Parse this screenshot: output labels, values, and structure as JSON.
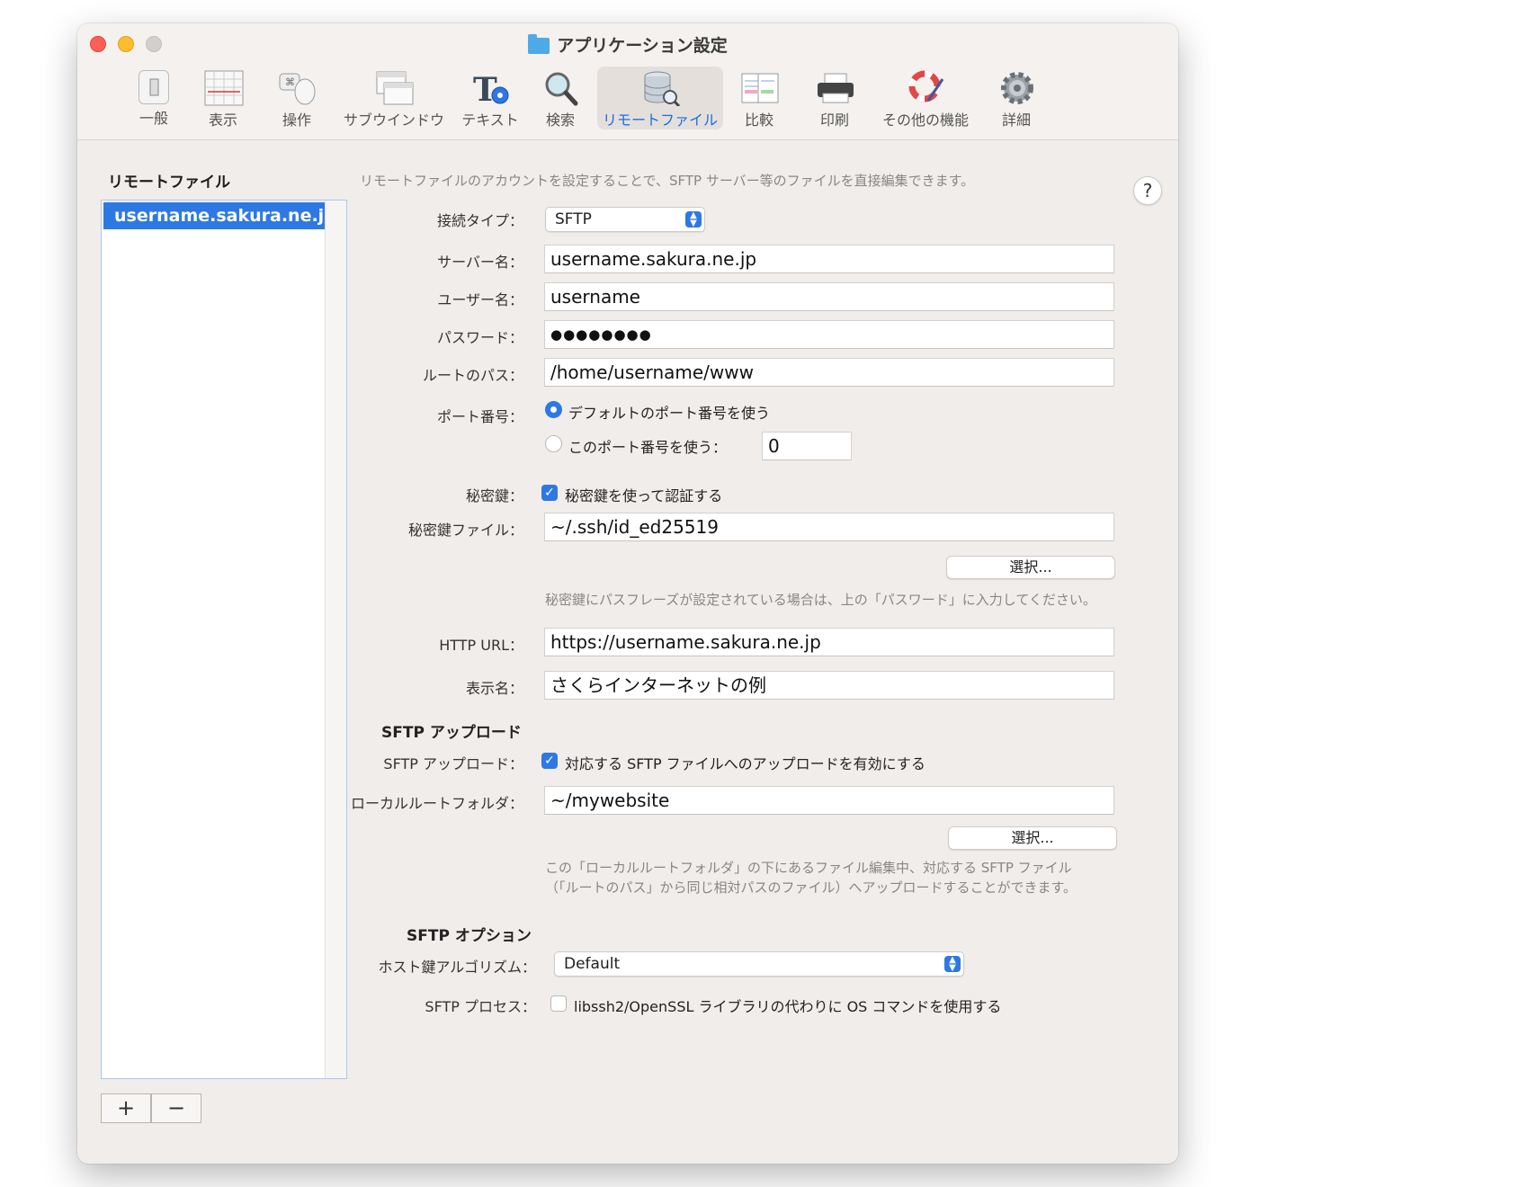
{
  "window": {
    "title": "アプリケーション設定"
  },
  "toolbar": {
    "items": [
      {
        "label": "一般",
        "icon": "switch-icon"
      },
      {
        "label": "表示",
        "icon": "display-grid-icon"
      },
      {
        "label": "操作",
        "icon": "mouse-keyboard-icon"
      },
      {
        "label": "サブウインドウ",
        "icon": "subwindow-icon"
      },
      {
        "label": "テキスト",
        "icon": "text-gear-icon"
      },
      {
        "label": "検索",
        "icon": "magnifier-icon"
      },
      {
        "label": "リモートファイル",
        "icon": "database-icon"
      },
      {
        "label": "比較",
        "icon": "compare-docs-icon"
      },
      {
        "label": "印刷",
        "icon": "printer-icon"
      },
      {
        "label": "その他の機能",
        "icon": "lifebuoy-icon"
      },
      {
        "label": "詳細",
        "icon": "gear-icon"
      }
    ],
    "active_index": 6,
    "active_color": "#1a6fe0"
  },
  "sidebar": {
    "title": "リモートファイル",
    "items": [
      {
        "label": "username.sakura.ne.jp"
      }
    ],
    "add_label": "+",
    "remove_label": "−"
  },
  "form": {
    "description": "リモートファイルのアカウントを設定することで、SFTP サーバー等のファイルを直接編集できます。",
    "help_label": "?",
    "connection_type": {
      "label": "接続タイプ：",
      "value": "SFTP"
    },
    "server": {
      "label": "サーバー名：",
      "value": "username.sakura.ne.jp"
    },
    "user": {
      "label": "ユーザー名：",
      "value": "username"
    },
    "password": {
      "label": "パスワード：",
      "value": "●●●●●●●●"
    },
    "root_path": {
      "label": "ルートのパス：",
      "value": "/home/username/www"
    },
    "port": {
      "label": "ポート番号：",
      "default_option": "デフォルトのポート番号を使う",
      "custom_option": "このポート番号を使う：",
      "value": "0",
      "selected": "default"
    },
    "private_key": {
      "label": "秘密鍵：",
      "checkbox_label": "秘密鍵を使って認証する",
      "checked": true
    },
    "private_key_file": {
      "label": "秘密鍵ファイル：",
      "value": "~/.ssh/id_ed25519",
      "choose_label": "選択..."
    },
    "private_key_note": "秘密鍵にパスフレーズが設定されている場合は、上の「パスワード」に入力してください。",
    "http_url": {
      "label": "HTTP URL：",
      "value": "https://username.sakura.ne.jp"
    },
    "display_name": {
      "label": "表示名：",
      "value": "さくらインターネットの例"
    }
  },
  "sftp_upload": {
    "section_title": "SFTP アップロード",
    "label": "SFTP アップロード：",
    "checkbox_label": "対応する SFTP ファイルへのアップロードを有効にする",
    "checked": true,
    "local_root": {
      "label": "ローカルルートフォルダ：",
      "value": "~/mywebsite",
      "choose_label": "選択..."
    },
    "note_line1": "この「ローカルルートフォルダ」の下にあるファイル編集中、対応する SFTP ファイル",
    "note_line2": "（「ルートのパス」から同じ相対パスのファイル）へアップロードすることができます。"
  },
  "sftp_options": {
    "section_title": "SFTP オプション",
    "host_key": {
      "label": "ホスト鍵アルゴリズム：",
      "value": "Default"
    },
    "process": {
      "label": "SFTP プロセス：",
      "checkbox_label": "libssh2/OpenSSL ライブラリの代わりに OS コマンドを使用する",
      "checked": false
    }
  }
}
